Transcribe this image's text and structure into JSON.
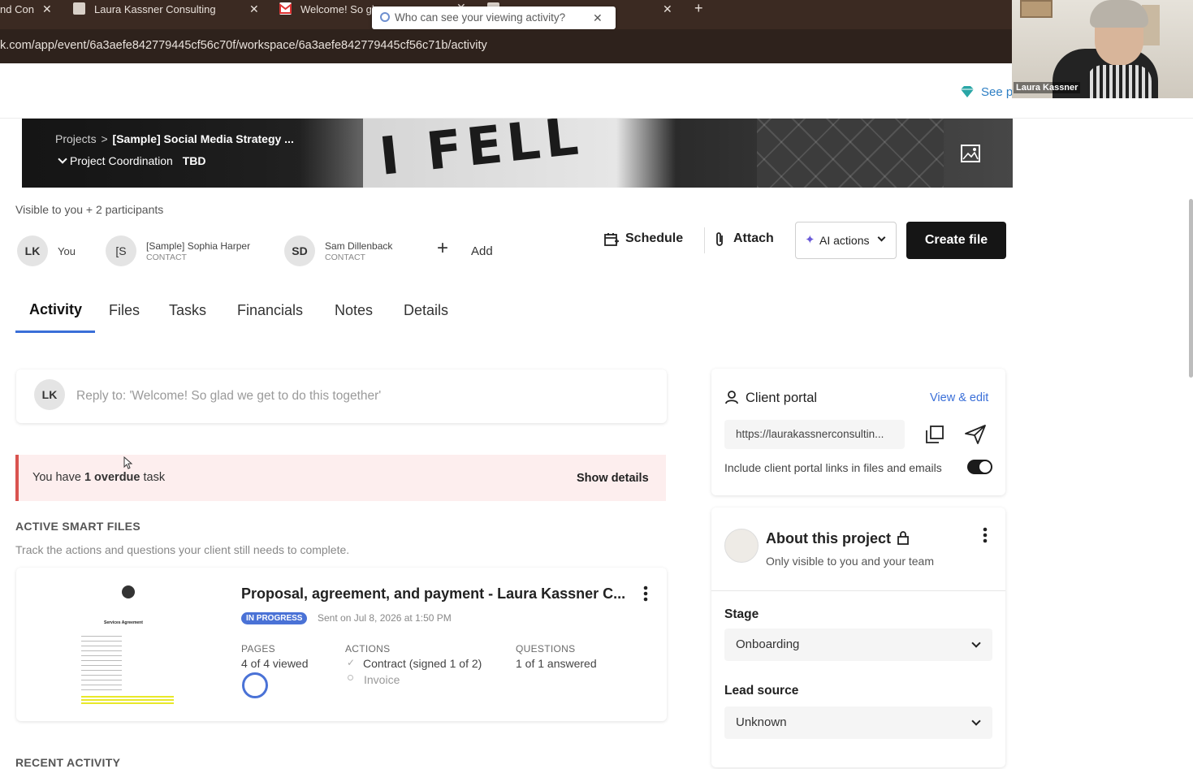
{
  "browser": {
    "tabs": [
      {
        "label": "nd Con"
      },
      {
        "label": "Laura Kassner Consulting"
      },
      {
        "label": "Welcome! So gl"
      },
      {
        "label": "Laura Kassner Consulting"
      }
    ],
    "new_tab": "+",
    "close_glyph": "✕",
    "popup_text": "Who can see your viewing activity?",
    "url": "k.com/app/event/6a3aefe842779445cf56c70f/workspace/6a3aefe842779445cf56c71b/activity"
  },
  "header": {
    "see_plans": "See p",
    "video_caller_name": "Laura Kassner"
  },
  "banner": {
    "breadcrumb_root": "Projects",
    "breadcrumb_sep": ">",
    "project_name": "[Sample] Social Media Strategy ...",
    "pipeline": "Project Coordination",
    "pipeline_value": "TBD",
    "banner_text": "I FELL"
  },
  "participants": {
    "visibility": "Visible to you + 2 participants",
    "people": [
      {
        "initials": "LK",
        "name": "You",
        "role": ""
      },
      {
        "initials": "[S",
        "name": "[Sample] Sophia Harper",
        "role": "CONTACT"
      },
      {
        "initials": "SD",
        "name": "Sam Dillenback",
        "role": "CONTACT"
      }
    ],
    "add_label": "Add"
  },
  "actions": {
    "schedule": "Schedule",
    "attach": "Attach",
    "ai_actions": "AI actions",
    "create_file": "Create file"
  },
  "tabs": [
    "Activity",
    "Files",
    "Tasks",
    "Financials",
    "Notes",
    "Details"
  ],
  "reply": {
    "initials": "LK",
    "placeholder": "Reply to: 'Welcome! So glad we get to do this together'"
  },
  "overdue": {
    "prefix": "You have ",
    "bold": "1 overdue",
    "suffix": " task",
    "show_details": "Show details"
  },
  "smart_files": {
    "heading": "ACTIVE SMART FILES",
    "subheading": "Track the actions and questions your client still needs to complete.",
    "file": {
      "title": "Proposal, agreement, and payment - Laura Kassner C...",
      "status": "IN PROGRESS",
      "sent": "Sent on Jul 8, 2026 at 1:50 PM",
      "pages_label": "PAGES",
      "pages_value": "4 of 4 viewed",
      "actions_label": "ACTIONS",
      "action_1": "Contract (signed 1 of 2)",
      "action_2": "Invoice",
      "questions_label": "QUESTIONS",
      "questions_value": "1 of 1 answered",
      "thumb_title": "Services Agreement"
    }
  },
  "recent_activity": "RECENT ACTIVITY",
  "client_portal": {
    "title": "Client portal",
    "view_edit": "View & edit",
    "link": "https://laurakassnerconsultin...",
    "include_label": "Include client portal links in files and emails",
    "toggle_on": true
  },
  "about": {
    "title": "About this project",
    "subtitle": "Only visible to you and your team",
    "stage_label": "Stage",
    "stage_value": "Onboarding",
    "lead_label": "Lead source",
    "lead_value": "Unknown"
  },
  "colors": {
    "accent_blue": "#3a6fd8",
    "overdue_bg": "#fdeeee",
    "overdue_bar": "#d9534f",
    "primary_button": "#151515"
  }
}
